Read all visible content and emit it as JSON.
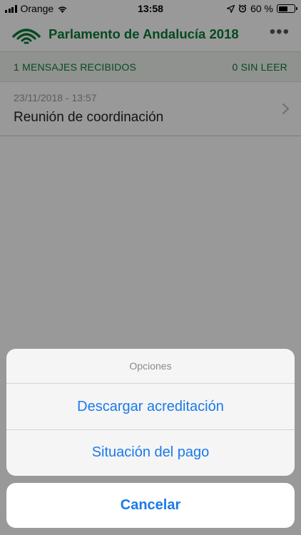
{
  "status_bar": {
    "carrier": "Orange",
    "time": "13:58",
    "battery_percent": "60 %",
    "battery_level": 0.6
  },
  "nav_bar": {
    "title": "Parlamento de Andalucía 2018",
    "more_icon": "•••",
    "logo_icon": "junta-de-andalucia-logo"
  },
  "summary": {
    "received": "1 MENSAJES RECIBIDOS",
    "unread": "0 SIN LEER"
  },
  "messages": [
    {
      "date": "23/11/2018 - 13:57",
      "title": "Reunión de coordinación"
    }
  ],
  "action_sheet": {
    "title": "Opciones",
    "actions": [
      "Descargar acreditación",
      "Situación del pago"
    ],
    "cancel_label": "Cancelar"
  },
  "colors": {
    "brand_green": "#0b7a37",
    "ios_blue": "#1a7ae8"
  }
}
